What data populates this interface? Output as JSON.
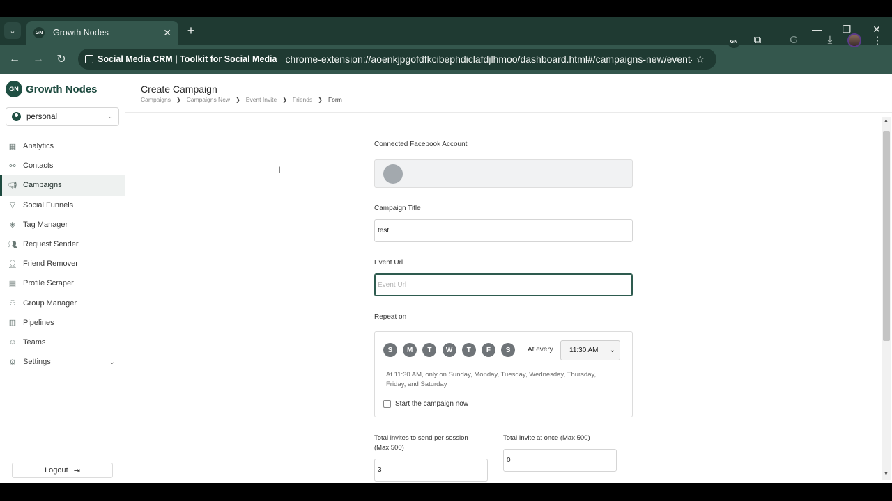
{
  "browser": {
    "tab_title": "Growth Nodes",
    "favicon_text": "GN",
    "site_chip": "Social Media CRM | Toolkit for Social Media",
    "url": "chrome-extension://aoenkjpgofdfkcibephdiclafdjlhmoo/dashboard.html#/campaigns-new/event-in..."
  },
  "sidebar": {
    "brand_logo": "GN",
    "brand_name": "Growth Nodes",
    "account": "personal",
    "items": [
      {
        "label": "Analytics",
        "icon": "analytics-icon"
      },
      {
        "label": "Contacts",
        "icon": "contacts-icon"
      },
      {
        "label": "Campaigns",
        "icon": "megaphone-icon",
        "active": true
      },
      {
        "label": "Social Funnels",
        "icon": "funnel-icon"
      },
      {
        "label": "Tag Manager",
        "icon": "tag-icon"
      },
      {
        "label": "Request Sender",
        "icon": "users-icon"
      },
      {
        "label": "Friend Remover",
        "icon": "user-remove-icon"
      },
      {
        "label": "Profile Scraper",
        "icon": "scraper-icon"
      },
      {
        "label": "Group Manager",
        "icon": "group-icon"
      },
      {
        "label": "Pipelines",
        "icon": "pipeline-icon"
      },
      {
        "label": "Teams",
        "icon": "team-icon"
      },
      {
        "label": "Settings",
        "icon": "gear-icon"
      }
    ],
    "logout": "Logout"
  },
  "header": {
    "title": "Create Campaign",
    "breadcrumb": [
      "Campaigns",
      "Campaigns New",
      "Event Invite",
      "Friends",
      "Form"
    ]
  },
  "form": {
    "fb_account_label": "Connected Facebook Account",
    "campaign_title_label": "Campaign Title",
    "campaign_title_value": "test",
    "event_url_label": "Event Url",
    "event_url_placeholder": "Event Url",
    "repeat_label": "Repeat on",
    "days": [
      "S",
      "M",
      "T",
      "W",
      "T",
      "F",
      "S"
    ],
    "at_every": "At every",
    "time": "11:30 AM",
    "schedule_text": "At 11:30 AM, only on Sunday, Monday, Tuesday, Wednesday, Thursday, Friday, and Saturday",
    "start_now": "Start the campaign now",
    "invites_per_session_label": "Total invites to send per session (Max 500)",
    "invites_per_session_value": "3",
    "invite_at_once_label": "Total Invite at once (Max 500)",
    "invite_at_once_value": "0"
  },
  "colors": {
    "brand_dark": "#1f3a32",
    "brand_green": "#1d4a3f",
    "day_chip": "#6f7478"
  }
}
